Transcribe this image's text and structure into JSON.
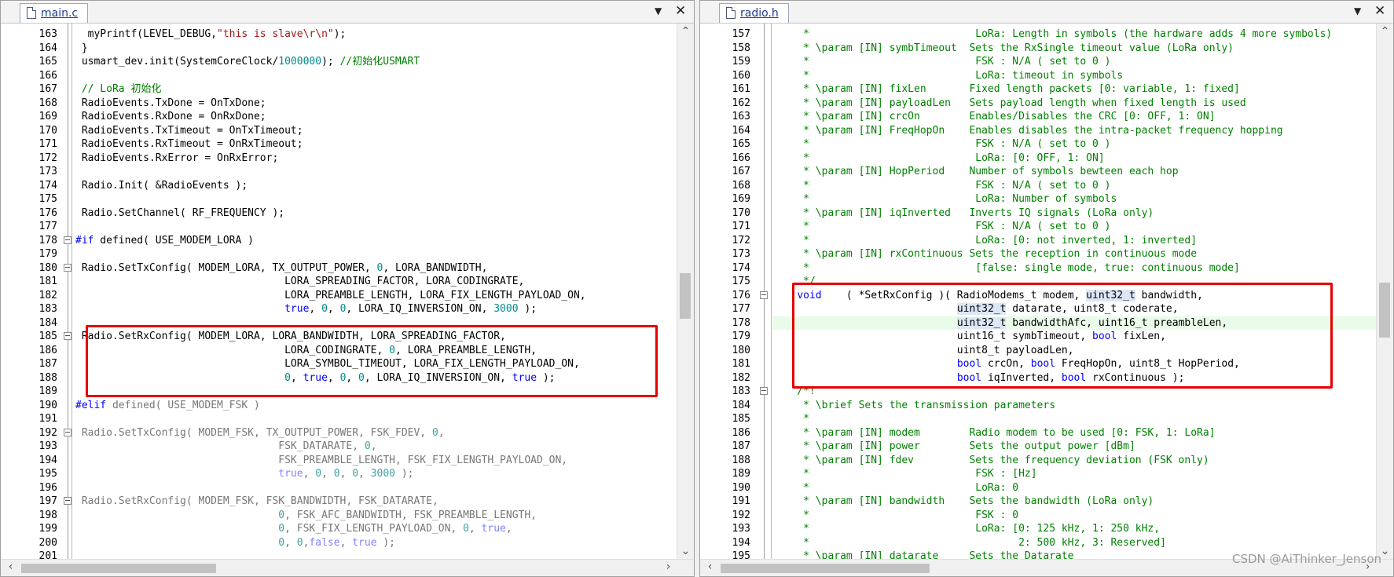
{
  "left_pane": {
    "tab_label": "main.c",
    "lines": [
      {
        "n": "163",
        "f": "",
        "h": "  myPrintf(LEVEL_DEBUG,<span class=\"str\">\"this is slave\\r\\n\"</span>);"
      },
      {
        "n": "164",
        "f": "",
        "h": " }"
      },
      {
        "n": "165",
        "f": "",
        "h": " usmart_dev.init(SystemCoreClock/<span class=\"num\">1000000</span>); <span class=\"cm\">//初始化USMART</span>"
      },
      {
        "n": "166",
        "f": "",
        "h": ""
      },
      {
        "n": "167",
        "f": "",
        "h": " <span class=\"cm\">// LoRa 初始化</span>"
      },
      {
        "n": "168",
        "f": "",
        "h": " RadioEvents.TxDone = OnTxDone;"
      },
      {
        "n": "169",
        "f": "",
        "h": " RadioEvents.RxDone = OnRxDone;"
      },
      {
        "n": "170",
        "f": "",
        "h": " RadioEvents.TxTimeout = OnTxTimeout;"
      },
      {
        "n": "171",
        "f": "",
        "h": " RadioEvents.RxTimeout = OnRxTimeout;"
      },
      {
        "n": "172",
        "f": "",
        "h": " RadioEvents.RxError = OnRxError;"
      },
      {
        "n": "173",
        "f": "",
        "h": ""
      },
      {
        "n": "174",
        "f": "",
        "h": " Radio.Init( &amp;RadioEvents );"
      },
      {
        "n": "175",
        "f": "",
        "h": ""
      },
      {
        "n": "176",
        "f": "",
        "h": " Radio.SetChannel( RF_FREQUENCY );"
      },
      {
        "n": "177",
        "f": "",
        "h": ""
      },
      {
        "n": "178",
        "f": "box",
        "h": "<span class=\"kw\">#if</span> defined( USE_MODEM_LORA )"
      },
      {
        "n": "179",
        "f": "",
        "h": ""
      },
      {
        "n": "180",
        "f": "box",
        "h": " Radio.SetTxConfig( MODEM_LORA, TX_OUTPUT_POWER, <span class=\"num\">0</span>, LORA_BANDWIDTH,"
      },
      {
        "n": "181",
        "f": "",
        "h": "                                  LORA_SPREADING_FACTOR, LORA_CODINGRATE,"
      },
      {
        "n": "182",
        "f": "",
        "h": "                                  LORA_PREAMBLE_LENGTH, LORA_FIX_LENGTH_PAYLOAD_ON,"
      },
      {
        "n": "183",
        "f": "",
        "h": "                                  <span class=\"kw\">true</span>, <span class=\"num\">0</span>, <span class=\"num\">0</span>, LORA_IQ_INVERSION_ON, <span class=\"num\">3000</span> );"
      },
      {
        "n": "184",
        "f": "",
        "h": ""
      },
      {
        "n": "185",
        "f": "box",
        "h": " Radio.SetRxConfig( MODEM_LORA, LORA_BANDWIDTH, LORA_SPREADING_FACTOR,"
      },
      {
        "n": "186",
        "f": "",
        "h": "                                  LORA_CODINGRATE, <span class=\"num\">0</span>, LORA_PREAMBLE_LENGTH,"
      },
      {
        "n": "187",
        "f": "",
        "h": "                                  LORA_SYMBOL_TIMEOUT, LORA_FIX_LENGTH_PAYLOAD_ON,"
      },
      {
        "n": "188",
        "f": "",
        "h": "                                  <span class=\"num\">0</span>, <span class=\"kw\">true</span>, <span class=\"num\">0</span>, <span class=\"num\">0</span>, LORA_IQ_INVERSION_ON, <span class=\"kw\">true</span> );"
      },
      {
        "n": "189",
        "f": "",
        "h": ""
      },
      {
        "n": "190",
        "f": "",
        "h": "<span class=\"kw\">#elif</span> <span class=\"dim\">defined( USE_MODEM_FSK )</span>"
      },
      {
        "n": "191",
        "f": "",
        "h": ""
      },
      {
        "n": "192",
        "f": "box",
        "h": "<span class=\"dim\"> Radio.SetTxConfig( MODEM_FSK, TX_OUTPUT_POWER, FSK_FDEV, <span class=\"dimnum\">0</span>,</span>"
      },
      {
        "n": "193",
        "f": "",
        "h": "<span class=\"dim\">                                 FSK_DATARATE, <span class=\"dimnum\">0</span>,</span>"
      },
      {
        "n": "194",
        "f": "",
        "h": "<span class=\"dim\">                                 FSK_PREAMBLE_LENGTH, FSK_FIX_LENGTH_PAYLOAD_ON,</span>"
      },
      {
        "n": "195",
        "f": "",
        "h": "<span class=\"dim\">                                 <span class=\"dimkw\">true</span>, <span class=\"dimnum\">0</span>, <span class=\"dimnum\">0</span>, <span class=\"dimnum\">0</span>, <span class=\"dimnum\">3000</span> );</span>"
      },
      {
        "n": "196",
        "f": "",
        "h": ""
      },
      {
        "n": "197",
        "f": "box",
        "h": "<span class=\"dim\"> Radio.SetRxConfig( MODEM_FSK, FSK_BANDWIDTH, FSK_DATARATE,</span>"
      },
      {
        "n": "198",
        "f": "",
        "h": "<span class=\"dim\">                                 <span class=\"dimnum\">0</span>, FSK_AFC_BANDWIDTH, FSK_PREAMBLE_LENGTH,</span>"
      },
      {
        "n": "199",
        "f": "",
        "h": "<span class=\"dim\">                                 <span class=\"dimnum\">0</span>, FSK_FIX_LENGTH_PAYLOAD_ON, <span class=\"dimnum\">0</span>, <span class=\"dimkw\">true</span>,</span>"
      },
      {
        "n": "200",
        "f": "",
        "h": "<span class=\"dim\">                                 <span class=\"dimnum\">0</span>, <span class=\"dimnum\">0</span>,<span class=\"dimkw\">false</span>, <span class=\"dimkw\">true</span> );</span>"
      },
      {
        "n": "201",
        "f": "",
        "h": ""
      }
    ]
  },
  "right_pane": {
    "tab_label": "radio.h",
    "lines": [
      {
        "n": "157",
        "f": "",
        "h": "<span class=\"cm\">     *                           LoRa: Length in symbols (the hardware adds 4 more symbols)</span>"
      },
      {
        "n": "158",
        "f": "",
        "h": "<span class=\"cm\">     * \\param [IN] symbTimeout  Sets the RxSingle timeout value (LoRa only)</span>"
      },
      {
        "n": "159",
        "f": "",
        "h": "<span class=\"cm\">     *                           FSK : N/A ( set to 0 )</span>"
      },
      {
        "n": "160",
        "f": "",
        "h": "<span class=\"cm\">     *                           LoRa: timeout in symbols</span>"
      },
      {
        "n": "161",
        "f": "",
        "h": "<span class=\"cm\">     * \\param [IN] fixLen       Fixed length packets [0: variable, 1: fixed]</span>"
      },
      {
        "n": "162",
        "f": "",
        "h": "<span class=\"cm\">     * \\param [IN] payloadLen   Sets payload length when fixed length is used</span>"
      },
      {
        "n": "163",
        "f": "",
        "h": "<span class=\"cm\">     * \\param [IN] crcOn        Enables/Disables the CRC [0: OFF, 1: ON]</span>"
      },
      {
        "n": "164",
        "f": "",
        "h": "<span class=\"cm\">     * \\param [IN] FreqHopOn    Enables disables the intra-packet frequency hopping</span>"
      },
      {
        "n": "165",
        "f": "",
        "h": "<span class=\"cm\">     *                           FSK : N/A ( set to 0 )</span>"
      },
      {
        "n": "166",
        "f": "",
        "h": "<span class=\"cm\">     *                           LoRa: [0: OFF, 1: ON]</span>"
      },
      {
        "n": "167",
        "f": "",
        "h": "<span class=\"cm\">     * \\param [IN] HopPeriod    Number of symbols bewteen each hop</span>"
      },
      {
        "n": "168",
        "f": "",
        "h": "<span class=\"cm\">     *                           FSK : N/A ( set to 0 )</span>"
      },
      {
        "n": "169",
        "f": "",
        "h": "<span class=\"cm\">     *                           LoRa: Number of symbols</span>"
      },
      {
        "n": "170",
        "f": "",
        "h": "<span class=\"cm\">     * \\param [IN] iqInverted   Inverts IQ signals (LoRa only)</span>"
      },
      {
        "n": "171",
        "f": "",
        "h": "<span class=\"cm\">     *                           FSK : N/A ( set to 0 )</span>"
      },
      {
        "n": "172",
        "f": "",
        "h": "<span class=\"cm\">     *                           LoRa: [0: not inverted, 1: inverted]</span>"
      },
      {
        "n": "173",
        "f": "",
        "h": "<span class=\"cm\">     * \\param [IN] rxContinuous Sets the reception in continuous mode</span>"
      },
      {
        "n": "174",
        "f": "",
        "h": "<span class=\"cm\">     *                           [false: single mode, true: continuous mode]</span>"
      },
      {
        "n": "175",
        "f": "",
        "h": "<span class=\"cm\">     */</span>"
      },
      {
        "n": "176",
        "f": "box",
        "h": "    <span class=\"kw\">void</span>    ( *SetRxConfig )( RadioModems_t modem, <span class=\"hl\">uint32_t</span> bandwidth,"
      },
      {
        "n": "177",
        "f": "",
        "h": "                              <span class=\"hl\">uint32_t</span> datarate, uint8_t coderate,"
      },
      {
        "n": "178",
        "f": "",
        "h": "                              <span class=\"hl\">uint32_t</span> bandwidthAfc, uint16_t preambleLen,"
      },
      {
        "n": "179",
        "f": "",
        "h": "                              uint16_t symbTimeout, <span class=\"kw\">bool</span> fixLen,"
      },
      {
        "n": "180",
        "f": "",
        "h": "                              uint8_t payloadLen,"
      },
      {
        "n": "181",
        "f": "",
        "h": "                              <span class=\"kw\">bool</span> crcOn, <span class=\"kw\">bool</span> FreqHopOn, uint8_t HopPeriod,"
      },
      {
        "n": "182",
        "f": "",
        "h": "                              <span class=\"kw\">bool</span> iqInverted, <span class=\"kw\">bool</span> rxContinuous );"
      },
      {
        "n": "183",
        "f": "box",
        "h": "<span class=\"cm\">    /*!</span>"
      },
      {
        "n": "184",
        "f": "",
        "h": "<span class=\"cm\">     * \\brief Sets the transmission parameters</span>"
      },
      {
        "n": "185",
        "f": "",
        "h": "<span class=\"cm\">     *</span>"
      },
      {
        "n": "186",
        "f": "",
        "h": "<span class=\"cm\">     * \\param [IN] modem        Radio modem to be used [0: FSK, 1: LoRa]</span>"
      },
      {
        "n": "187",
        "f": "",
        "h": "<span class=\"cm\">     * \\param [IN] power        Sets the output power [dBm]</span>"
      },
      {
        "n": "188",
        "f": "",
        "h": "<span class=\"cm\">     * \\param [IN] fdev         Sets the frequency deviation (FSK only)</span>"
      },
      {
        "n": "189",
        "f": "",
        "h": "<span class=\"cm\">     *                           FSK : [Hz]</span>"
      },
      {
        "n": "190",
        "f": "",
        "h": "<span class=\"cm\">     *                           LoRa: 0</span>"
      },
      {
        "n": "191",
        "f": "",
        "h": "<span class=\"cm\">     * \\param [IN] bandwidth    Sets the bandwidth (LoRa only)</span>"
      },
      {
        "n": "192",
        "f": "",
        "h": "<span class=\"cm\">     *                           FSK : 0</span>"
      },
      {
        "n": "193",
        "f": "",
        "h": "<span class=\"cm\">     *                           LoRa: [0: 125 kHz, 1: 250 kHz,</span>"
      },
      {
        "n": "194",
        "f": "",
        "h": "<span class=\"cm\">     *                                  2: 500 kHz, 3: Reserved]</span>"
      },
      {
        "n": "195",
        "f": "",
        "h": "<span class=\"cm\">     * \\param [IN] datarate     Sets the Datarate</span>"
      }
    ]
  },
  "watermark": "CSDN @AiThinker_Jenson",
  "colors": {
    "keyword": "#0000ff",
    "comment": "#008000",
    "number": "#008b8b",
    "string": "#a31515",
    "highlight_box": "#e60000",
    "current_line": "#e9fbe9"
  }
}
